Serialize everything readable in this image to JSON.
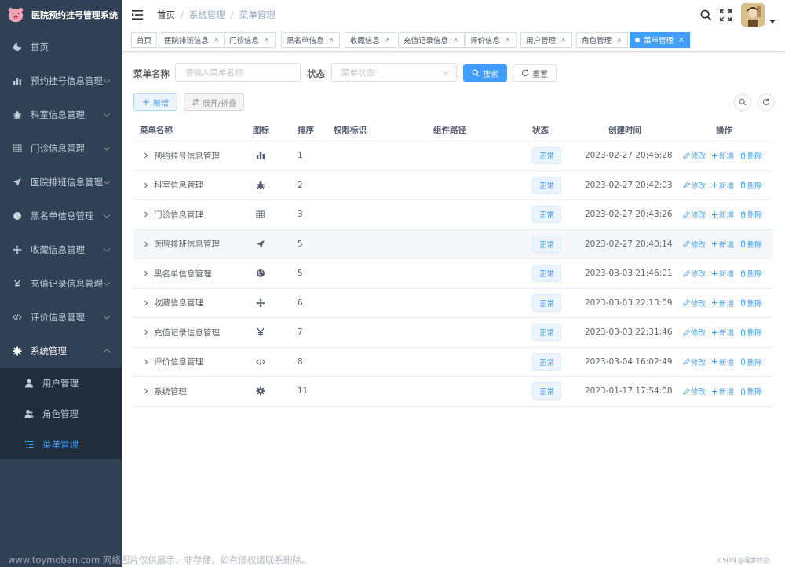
{
  "app": {
    "title": "医院预约挂号管理系统"
  },
  "sidebar": {
    "items": [
      {
        "label": "首页",
        "icon": "dashboard-icon"
      },
      {
        "label": "预约挂号信息管理",
        "icon": "bar-chart-icon"
      },
      {
        "label": "科室信息管理",
        "icon": "bug-icon"
      },
      {
        "label": "门诊信息管理",
        "icon": "table-icon"
      },
      {
        "label": "医院排班信息管理",
        "icon": "send-icon"
      },
      {
        "label": "黑名单信息管理",
        "icon": "globe-icon"
      },
      {
        "label": "收藏信息管理",
        "icon": "move-icon"
      },
      {
        "label": "充值记录信息管理",
        "icon": "yen-icon"
      },
      {
        "label": "评价信息管理",
        "icon": "code-icon"
      },
      {
        "label": "系统管理",
        "icon": "gear-icon"
      }
    ],
    "subitems": [
      {
        "label": "用户管理",
        "icon": "user-icon"
      },
      {
        "label": "角色管理",
        "icon": "peoples-icon"
      },
      {
        "label": "菜单管理",
        "icon": "tree-table-icon"
      }
    ]
  },
  "header": {
    "breadcrumb": [
      "首页",
      "系统管理",
      "菜单管理"
    ]
  },
  "tags": [
    "首页",
    "医院排班信息",
    "门诊信息",
    "黑名单信息",
    "收藏信息",
    "充值记录信息",
    "评价信息",
    "用户管理",
    "角色管理",
    "菜单管理"
  ],
  "search": {
    "name_label": "菜单名称",
    "name_placeholder": "请输入菜单名称",
    "status_label": "状态",
    "status_placeholder": "菜单状态",
    "search_btn": "搜索",
    "reset_btn": "重置"
  },
  "toolbar": {
    "add_btn": "新增",
    "expand_btn": "展开/折叠"
  },
  "table": {
    "columns": [
      "菜单名称",
      "图标",
      "排序",
      "权限标识",
      "组件路径",
      "状态",
      "创建时间",
      "操作"
    ],
    "rows": [
      {
        "name": "预约挂号信息管理",
        "icon": "bar-chart-icon",
        "order": "1",
        "status": "正常",
        "created": "2023-02-27 20:46:28"
      },
      {
        "name": "科室信息管理",
        "icon": "bug-icon",
        "order": "2",
        "status": "正常",
        "created": "2023-02-27 20:42:03"
      },
      {
        "name": "门诊信息管理",
        "icon": "table-icon",
        "order": "3",
        "status": "正常",
        "created": "2023-02-27 20:43:26"
      },
      {
        "name": "医院排班信息管理",
        "icon": "send-icon",
        "order": "5",
        "status": "正常",
        "created": "2023-02-27 20:40:14"
      },
      {
        "name": "黑名单信息管理",
        "icon": "globe-icon",
        "order": "5",
        "status": "正常",
        "created": "2023-03-03 21:46:01"
      },
      {
        "name": "收藏信息管理",
        "icon": "move-icon",
        "order": "6",
        "status": "正常",
        "created": "2023-03-03 22:13:09"
      },
      {
        "name": "充值记录信息管理",
        "icon": "yen-icon",
        "order": "7",
        "status": "正常",
        "created": "2023-03-03 22:31:46"
      },
      {
        "name": "评价信息管理",
        "icon": "code-icon",
        "order": "8",
        "status": "正常",
        "created": "2023-03-04 16:02:49"
      },
      {
        "name": "系统管理",
        "icon": "gear-icon",
        "order": "11",
        "status": "正常",
        "created": "2023-01-17 17:54:08"
      }
    ],
    "ops": {
      "edit": "修改",
      "add": "新增",
      "delete": "删除"
    }
  },
  "watermark": "www.toymoban.com 网络图片仅供展示，非存储，如有侵权请联系删除。",
  "credit": "CSDN @是梦终空",
  "colors": {
    "sidebar_bg": "#304156",
    "submenu_bg": "#1f2d3d",
    "primary": "#409eff"
  }
}
